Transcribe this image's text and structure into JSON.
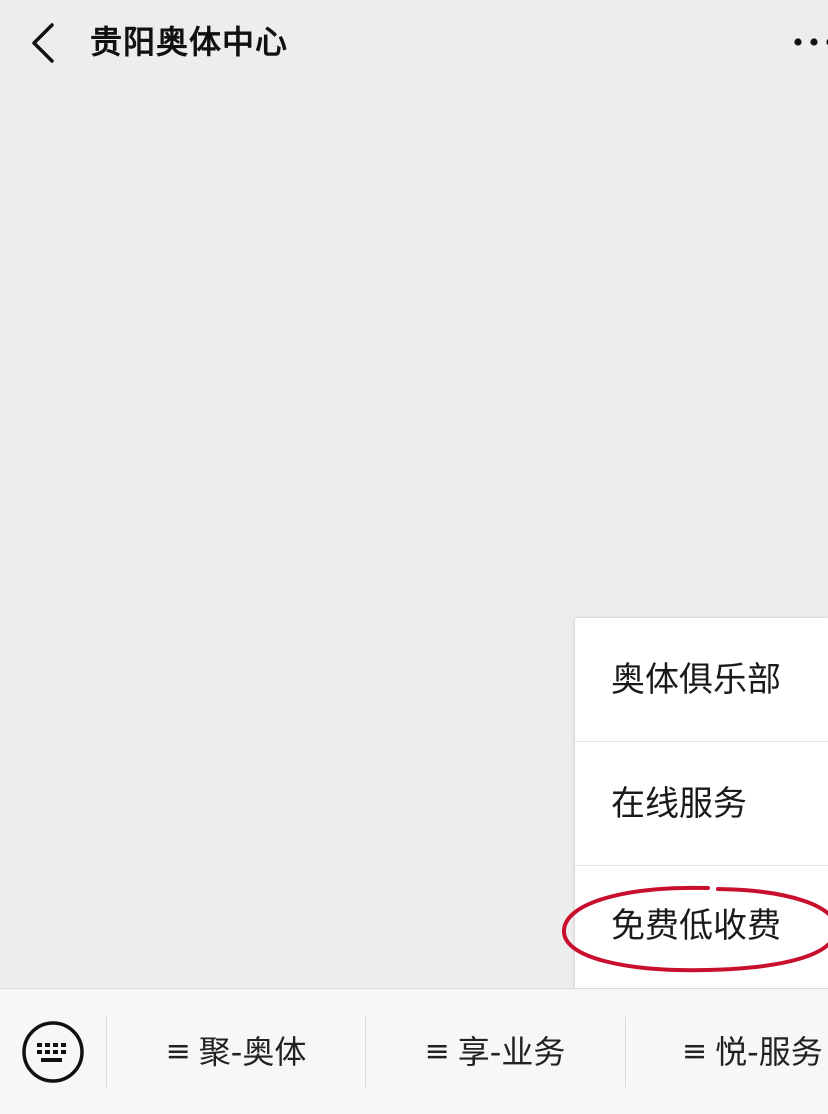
{
  "header": {
    "title": "贵阳奥体中心",
    "back_icon": "chevron-left-icon",
    "more_icon": "more-dots-icon"
  },
  "popup_menu": {
    "items": [
      {
        "label": "奥体俱乐部"
      },
      {
        "label": "在线服务"
      },
      {
        "label": "免费低收费",
        "highlighted": true
      }
    ]
  },
  "bottom_bar": {
    "keyboard_icon": "keyboard-icon",
    "menu_icon_glyph": "≡",
    "tabs": [
      {
        "label": "聚-奥体"
      },
      {
        "label": "享-业务"
      },
      {
        "label": "悦-服务"
      }
    ]
  },
  "colors": {
    "background": "#ededed",
    "menu_background": "#ffffff",
    "highlight_oval": "#c8102e"
  }
}
